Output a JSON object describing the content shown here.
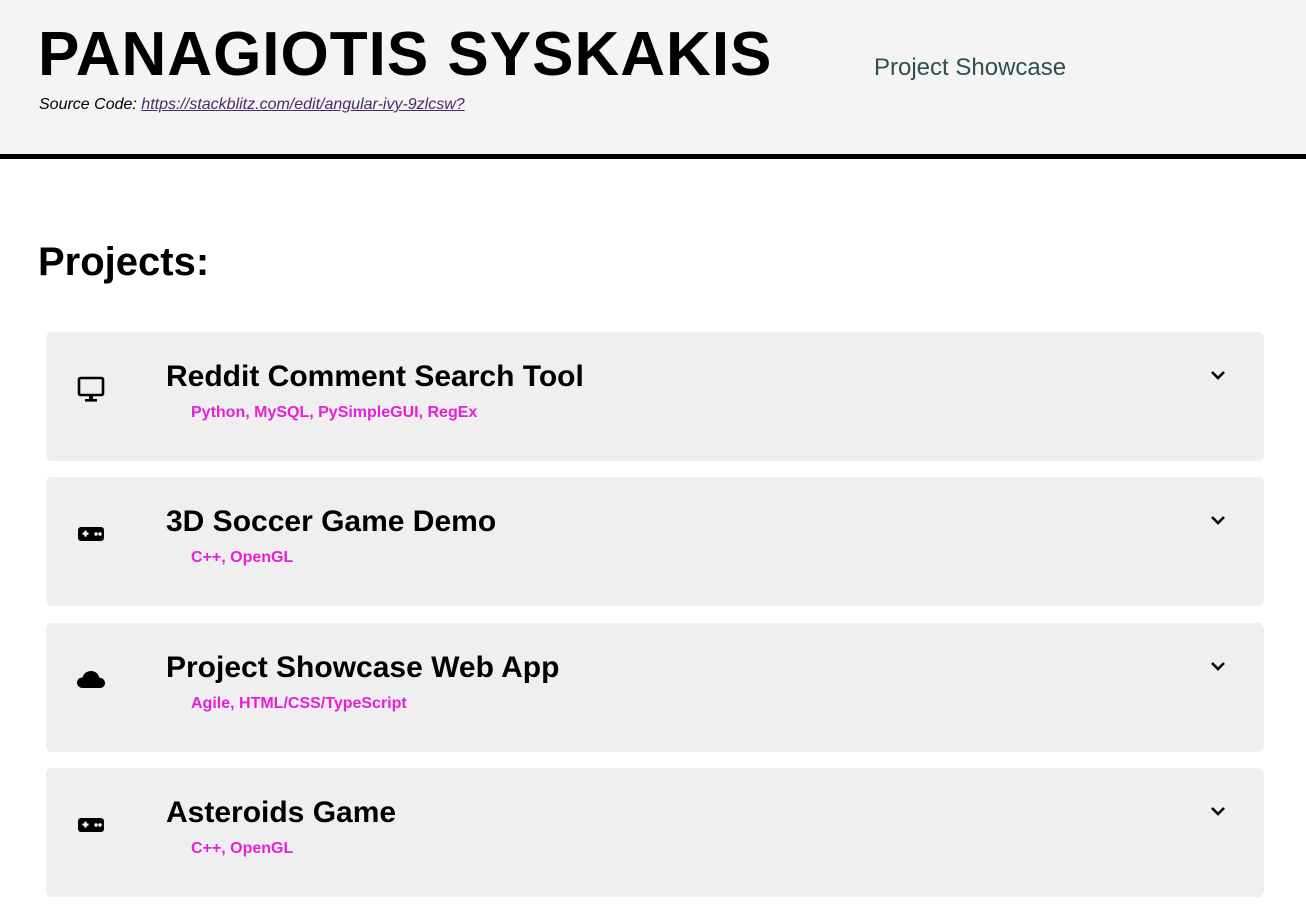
{
  "header": {
    "title": "PANAGIOTIS SYSKAKIS",
    "subtitle": "Project Showcase",
    "source_label": "Source Code:",
    "source_link": "https://stackblitz.com/edit/angular-ivy-9zlcsw?"
  },
  "main": {
    "section_title": "Projects:",
    "projects": [
      {
        "icon": "monitor-icon",
        "title": "Reddit Comment Search Tool",
        "tags": "Python, MySQL, PySimpleGUI, RegEx"
      },
      {
        "icon": "gamepad-icon",
        "title": "3D Soccer Game Demo",
        "tags": "C++, OpenGL"
      },
      {
        "icon": "cloud-icon",
        "title": "Project Showcase Web App",
        "tags": "Agile, HTML/CSS/TypeScript"
      },
      {
        "icon": "gamepad-icon",
        "title": "Asteroids Game",
        "tags": "C++, OpenGL"
      }
    ]
  },
  "colors": {
    "header_bg": "#f4f4f4",
    "card_bg": "#efefef",
    "tag_color": "#e81ed8",
    "subtitle_color": "#2f4f4f",
    "link_color": "#4b2a6b"
  }
}
